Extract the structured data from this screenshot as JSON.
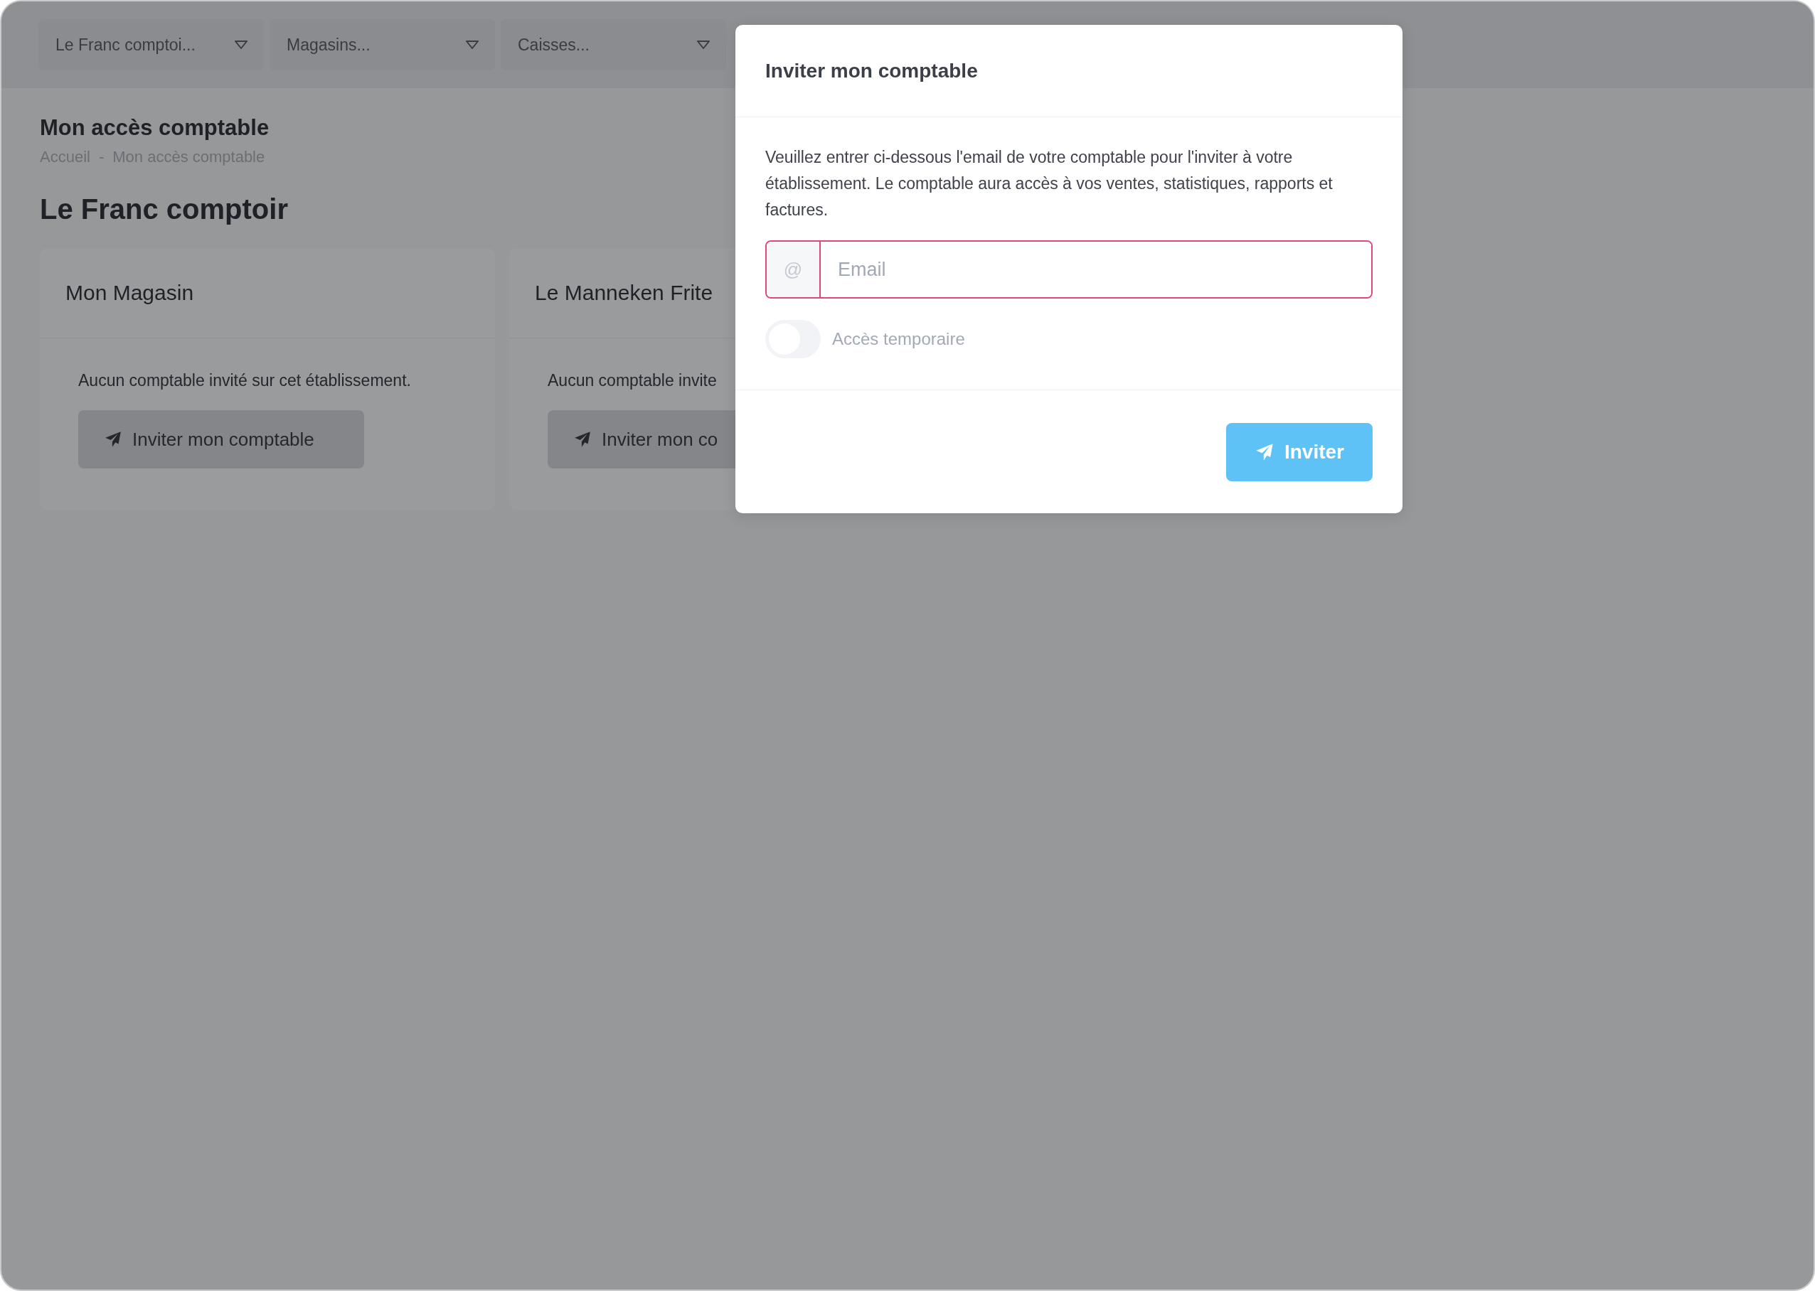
{
  "filters": [
    {
      "label": "Le Franc comptoi..."
    },
    {
      "label": "Magasins..."
    },
    {
      "label": "Caisses..."
    }
  ],
  "page": {
    "title": "Mon accès comptable",
    "breadcrumb": [
      "Accueil",
      "Mon accès comptable"
    ],
    "breadcrumb_separator": "-",
    "heading": "Le Franc comptoir"
  },
  "stores": [
    {
      "name": "Mon Magasin",
      "message": "Aucun comptable invité sur cet établissement.",
      "button": "Inviter mon comptable"
    },
    {
      "name": "Le Manneken Frite",
      "message": "Aucun comptable invite",
      "button": "Inviter mon co"
    }
  ],
  "modal": {
    "title": "Inviter mon comptable",
    "description": "Veuillez entrer ci-dessous l'email de votre comptable pour l'inviter à votre établissement. Le comptable aura accès à vos ventes, statistiques, rapports et factures.",
    "email": {
      "prefix": "@",
      "placeholder": "Email",
      "invalid": true
    },
    "temporary_access": {
      "label": "Accès temporaire",
      "on": false
    },
    "submit": {
      "label": "Inviter",
      "disabled": true
    }
  }
}
